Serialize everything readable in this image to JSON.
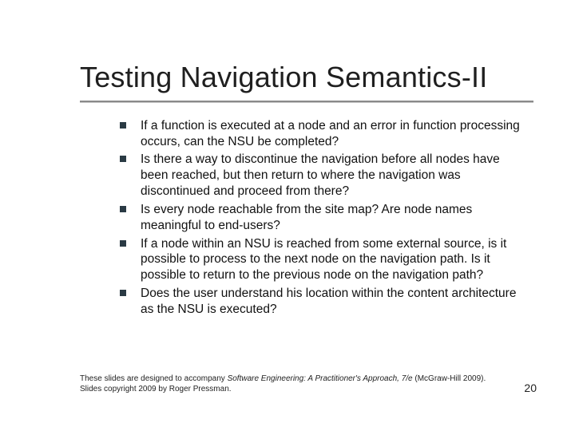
{
  "slide": {
    "title": "Testing Navigation Semantics-II",
    "bullets": [
      "If a function is executed at a node and an error in function processing occurs, can the NSU be completed?",
      "Is there a way to discontinue the navigation before all nodes have been reached, but then return to where the navigation was discontinued and proceed from there?",
      "Is every node reachable from the site map? Are node names meaningful to end-users?",
      "If a node within an NSU is reached from some external source, is it possible to process to the next node on the navigation path. Is it possible to return to the previous node on the navigation path?",
      "Does the user understand his location within the content architecture as the NSU is executed?"
    ],
    "footer": {
      "prefix": "These slides are designed to accompany ",
      "book_title": "Software Engineering: A Practitioner's Approach, 7/e",
      "suffix": " (McGraw-Hill 2009). Slides copyright 2009 by Roger Pressman.",
      "page_number": "20"
    }
  }
}
